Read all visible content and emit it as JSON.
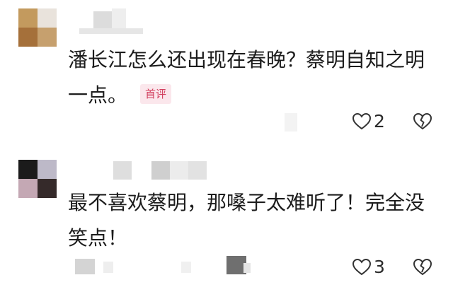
{
  "comments": [
    {
      "text": "潘长江怎么还出现在春晚？蔡明自知之明一点。",
      "badge": "首评",
      "likes": "2",
      "like_icon": "heart-outline-icon",
      "dislike_icon": "broken-heart-icon"
    },
    {
      "text": "最不喜欢蔡明，那嗓子太难听了！完全没笑点！",
      "likes": "3",
      "like_icon": "heart-outline-icon",
      "dislike_icon": "broken-heart-icon"
    }
  ],
  "colors": {
    "badge_bg": "#fbe7ec",
    "badge_text": "#d2405f",
    "text": "#1c1c1c",
    "icon": "#333333"
  }
}
